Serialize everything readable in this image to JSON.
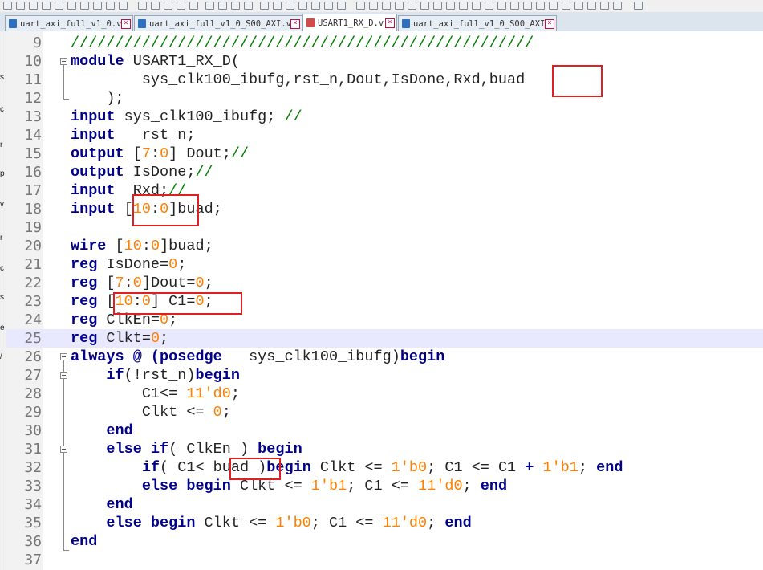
{
  "tabs": [
    {
      "label": "uart_axi_full_v1_0.v",
      "active": false,
      "modified": false,
      "icon": "file-icon"
    },
    {
      "label": "uart_axi_full_v1_0_S00_AXI.v",
      "active": false,
      "modified": false,
      "icon": "file-icon"
    },
    {
      "label": "USART1_RX_D.v",
      "active": true,
      "modified": true,
      "icon": "file-modified-icon"
    },
    {
      "label": "uart_axi_full_v1_0_S00_AXI.v",
      "active": false,
      "modified": false,
      "icon": "file-icon"
    }
  ],
  "left_strip_chars": [
    "s",
    "c",
    "r",
    "p",
    "v",
    "r",
    "c",
    "s",
    "e",
    "/"
  ],
  "colors": {
    "keyword": "#00008b",
    "number": "#ff8000",
    "comment": "#008000",
    "highlight_box": "#e02020",
    "current_line": "#e8e8ff"
  },
  "editor": {
    "current_line": 25,
    "lines": [
      {
        "n": "9",
        "tokens": [
          {
            "t": "////////////////////////////////////////////////////",
            "c": "cmt"
          }
        ]
      },
      {
        "n": "10",
        "tokens": [
          {
            "t": "module",
            "c": "kw"
          },
          {
            "t": " USART1_RX_D(",
            "c": ""
          }
        ]
      },
      {
        "n": "11",
        "tokens": [
          {
            "t": "        sys_clk100_ibufg,rst_n,Dout,IsDone,Rxd,buad",
            "c": ""
          }
        ]
      },
      {
        "n": "12",
        "tokens": [
          {
            "t": "    );",
            "c": ""
          }
        ]
      },
      {
        "n": "13",
        "tokens": [
          {
            "t": "input",
            "c": "kw"
          },
          {
            "t": " sys_clk100_ibufg; ",
            "c": ""
          },
          {
            "t": "//",
            "c": "cmt"
          }
        ]
      },
      {
        "n": "14",
        "tokens": [
          {
            "t": "input",
            "c": "kw"
          },
          {
            "t": "   rst_n;",
            "c": ""
          }
        ]
      },
      {
        "n": "15",
        "tokens": [
          {
            "t": "output",
            "c": "kw"
          },
          {
            "t": " [",
            "c": ""
          },
          {
            "t": "7",
            "c": "num"
          },
          {
            "t": ":",
            "c": ""
          },
          {
            "t": "0",
            "c": "num"
          },
          {
            "t": "] Dout;",
            "c": ""
          },
          {
            "t": "//",
            "c": "cmt"
          }
        ]
      },
      {
        "n": "16",
        "tokens": [
          {
            "t": "output",
            "c": "kw"
          },
          {
            "t": " IsDone;",
            "c": ""
          },
          {
            "t": "//",
            "c": "cmt"
          }
        ]
      },
      {
        "n": "17",
        "tokens": [
          {
            "t": "input",
            "c": "kw"
          },
          {
            "t": "  Rxd;",
            "c": ""
          },
          {
            "t": "//",
            "c": "cmt"
          }
        ]
      },
      {
        "n": "18",
        "tokens": [
          {
            "t": "input",
            "c": "kw"
          },
          {
            "t": " [",
            "c": ""
          },
          {
            "t": "10",
            "c": "num"
          },
          {
            "t": ":",
            "c": ""
          },
          {
            "t": "0",
            "c": "num"
          },
          {
            "t": "]buad;",
            "c": ""
          }
        ]
      },
      {
        "n": "19",
        "tokens": []
      },
      {
        "n": "20",
        "tokens": [
          {
            "t": "wire",
            "c": "kw"
          },
          {
            "t": " [",
            "c": ""
          },
          {
            "t": "10",
            "c": "num"
          },
          {
            "t": ":",
            "c": ""
          },
          {
            "t": "0",
            "c": "num"
          },
          {
            "t": "]buad;",
            "c": ""
          }
        ]
      },
      {
        "n": "21",
        "tokens": [
          {
            "t": "reg",
            "c": "kw"
          },
          {
            "t": " IsDone=",
            "c": ""
          },
          {
            "t": "0",
            "c": "num"
          },
          {
            "t": ";",
            "c": ""
          }
        ]
      },
      {
        "n": "22",
        "tokens": [
          {
            "t": "reg",
            "c": "kw"
          },
          {
            "t": " [",
            "c": ""
          },
          {
            "t": "7",
            "c": "num"
          },
          {
            "t": ":",
            "c": ""
          },
          {
            "t": "0",
            "c": "num"
          },
          {
            "t": "]Dout=",
            "c": ""
          },
          {
            "t": "0",
            "c": "num"
          },
          {
            "t": ";",
            "c": ""
          }
        ]
      },
      {
        "n": "23",
        "tokens": [
          {
            "t": "reg",
            "c": "kw"
          },
          {
            "t": " [",
            "c": ""
          },
          {
            "t": "10",
            "c": "num"
          },
          {
            "t": ":",
            "c": ""
          },
          {
            "t": "0",
            "c": "num"
          },
          {
            "t": "] C1=",
            "c": ""
          },
          {
            "t": "0",
            "c": "num"
          },
          {
            "t": ";",
            "c": ""
          }
        ]
      },
      {
        "n": "24",
        "tokens": [
          {
            "t": "reg",
            "c": "kw"
          },
          {
            "t": " ClkEn=",
            "c": ""
          },
          {
            "t": "0",
            "c": "num"
          },
          {
            "t": ";",
            "c": ""
          }
        ]
      },
      {
        "n": "25",
        "tokens": [
          {
            "t": "reg",
            "c": "kw"
          },
          {
            "t": " Clkt=",
            "c": ""
          },
          {
            "t": "0",
            "c": "num"
          },
          {
            "t": ";",
            "c": ""
          }
        ]
      },
      {
        "n": "26",
        "tokens": [
          {
            "t": "always",
            "c": "kw"
          },
          {
            "t": " @ (",
            "c": "op"
          },
          {
            "t": "posedge",
            "c": "kw"
          },
          {
            "t": "   sys_clk100_ibufg)",
            "c": ""
          },
          {
            "t": "begin",
            "c": "kw"
          }
        ]
      },
      {
        "n": "27",
        "tokens": [
          {
            "t": "    ",
            "c": ""
          },
          {
            "t": "if",
            "c": "kw"
          },
          {
            "t": "(!rst_n)",
            "c": ""
          },
          {
            "t": "begin",
            "c": "kw"
          }
        ]
      },
      {
        "n": "28",
        "tokens": [
          {
            "t": "        C1<= ",
            "c": ""
          },
          {
            "t": "11'd0",
            "c": "num"
          },
          {
            "t": ";",
            "c": ""
          }
        ]
      },
      {
        "n": "29",
        "tokens": [
          {
            "t": "        Clkt <= ",
            "c": ""
          },
          {
            "t": "0",
            "c": "num"
          },
          {
            "t": ";",
            "c": ""
          }
        ]
      },
      {
        "n": "30",
        "tokens": [
          {
            "t": "    ",
            "c": ""
          },
          {
            "t": "end",
            "c": "kw"
          }
        ]
      },
      {
        "n": "31",
        "tokens": [
          {
            "t": "    ",
            "c": ""
          },
          {
            "t": "else if",
            "c": "kw"
          },
          {
            "t": "( ClkEn ) ",
            "c": ""
          },
          {
            "t": "begin",
            "c": "kw"
          }
        ]
      },
      {
        "n": "32",
        "tokens": [
          {
            "t": "        ",
            "c": ""
          },
          {
            "t": "if",
            "c": "kw"
          },
          {
            "t": "( C1< buad )",
            "c": ""
          },
          {
            "t": "begin",
            "c": "kw"
          },
          {
            "t": " Clkt <= ",
            "c": ""
          },
          {
            "t": "1'b0",
            "c": "num"
          },
          {
            "t": "; C1 <= C1 ",
            "c": ""
          },
          {
            "t": "+",
            "c": "op"
          },
          {
            "t": " ",
            "c": ""
          },
          {
            "t": "1'b1",
            "c": "num"
          },
          {
            "t": "; ",
            "c": ""
          },
          {
            "t": "end",
            "c": "kw"
          }
        ]
      },
      {
        "n": "33",
        "tokens": [
          {
            "t": "        ",
            "c": ""
          },
          {
            "t": "else begin",
            "c": "kw"
          },
          {
            "t": " Clkt <= ",
            "c": ""
          },
          {
            "t": "1'b1",
            "c": "num"
          },
          {
            "t": "; C1 <= ",
            "c": ""
          },
          {
            "t": "11'd0",
            "c": "num"
          },
          {
            "t": "; ",
            "c": ""
          },
          {
            "t": "end",
            "c": "kw"
          }
        ]
      },
      {
        "n": "34",
        "tokens": [
          {
            "t": "    ",
            "c": ""
          },
          {
            "t": "end",
            "c": "kw"
          }
        ]
      },
      {
        "n": "35",
        "tokens": [
          {
            "t": "    ",
            "c": ""
          },
          {
            "t": "else begin",
            "c": "kw"
          },
          {
            "t": " Clkt <= ",
            "c": ""
          },
          {
            "t": "1'b0",
            "c": "num"
          },
          {
            "t": "; C1 <= ",
            "c": ""
          },
          {
            "t": "11'd0",
            "c": "num"
          },
          {
            "t": "; ",
            "c": ""
          },
          {
            "t": "end",
            "c": "kw"
          }
        ]
      },
      {
        "n": "36",
        "tokens": [
          {
            "t": "end",
            "c": "kw"
          }
        ]
      },
      {
        "n": "37",
        "tokens": []
      }
    ]
  }
}
